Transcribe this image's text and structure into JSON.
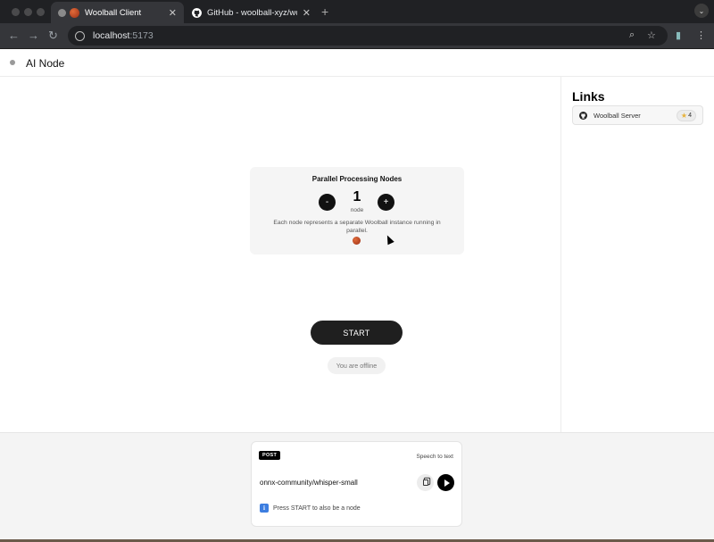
{
  "browser": {
    "tabs": [
      {
        "title": "Woolball Client",
        "active": true,
        "favicon": "yarn-ball-icon"
      },
      {
        "title": "GitHub - woolball-xyz/woolba",
        "active": false,
        "favicon": "github-icon"
      }
    ],
    "url": {
      "host": "localhost",
      "port": ":5173"
    }
  },
  "header": {
    "title": "AI Node",
    "status_color": "#9a9a9a"
  },
  "sidebar": {
    "title": "Links",
    "links": [
      {
        "label": "Woolball Server",
        "stars": "4",
        "icon": "github-icon"
      }
    ]
  },
  "nodes": {
    "title": "Parallel Processing Nodes",
    "decrement_label": "-",
    "increment_label": "+",
    "count": "1",
    "unit": "node",
    "description": "Each node represents a separate Woolball instance running in parallel."
  },
  "actions": {
    "start_label": "START",
    "status": "You are offline"
  },
  "request": {
    "method": "POST",
    "task": "Speech to text",
    "model": "onnx-community/whisper-small",
    "info": "Press START to also be a node"
  },
  "colors": {
    "accent": "#1f1f1f",
    "info_blue": "#3d7ee0",
    "star": "#e7b23a"
  }
}
